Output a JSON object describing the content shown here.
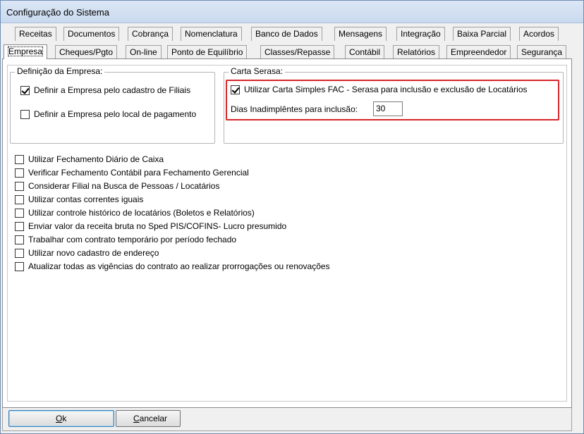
{
  "window": {
    "title": "Configuração do Sistema"
  },
  "tabs_row1": [
    "Receitas",
    "Documentos",
    "Cobrança",
    "Nomenclatura",
    "Banco de Dados",
    "Mensagens",
    "Integração",
    "Baixa Parcial",
    "Acordos"
  ],
  "tabs_row2": [
    "Empresa",
    "Cheques/Pgto",
    "On-line",
    "Ponto de Equilíbrio",
    "Classes/Repasse",
    "Contábil",
    "Relatórios",
    "Empreendedor",
    "Segurança"
  ],
  "active_tab": "Empresa",
  "definicao": {
    "legend": "Definição da Empresa:",
    "opt_filiais": {
      "label": "Definir a Empresa pelo cadastro de Filiais",
      "checked": true
    },
    "opt_local": {
      "label": "Definir a Empresa pelo local de pagamento",
      "checked": false
    }
  },
  "serasa": {
    "legend": "Carta Serasa:",
    "opt_carta": {
      "label": "Utilizar Carta Simples FAC - Serasa para inclusão e exclusão de Locatários",
      "checked": true
    },
    "dias_label": "Dias Inadimplêntes para inclusão:",
    "dias_value": "30",
    "highlight_color": "#d7262b"
  },
  "options": [
    {
      "label": "Utilizar Fechamento Diário de Caixa",
      "checked": false
    },
    {
      "label": "Verificar Fechamento Contábil para Fechamento Gerencial",
      "checked": false
    },
    {
      "label": "Considerar Filial na Busca de Pessoas / Locatários",
      "checked": false
    },
    {
      "label": "Utilizar contas correntes iguais",
      "checked": false
    },
    {
      "label": "Utilizar controle histórico de locatários (Boletos e Relatórios)",
      "checked": false
    },
    {
      "label": "Enviar valor da receita bruta no Sped PIS/COFINS- Lucro presumido",
      "checked": false
    },
    {
      "label": "Trabalhar com contrato temporário por período fechado",
      "checked": false
    },
    {
      "label": "Utilizar novo cadastro de endereço",
      "checked": false
    },
    {
      "label": "Atualizar todas as vigências do contrato ao realizar prorrogações ou renovações",
      "checked": false
    }
  ],
  "buttons": {
    "ok": {
      "mnemonic": "O",
      "rest": "k"
    },
    "cancel": {
      "mnemonic": "C",
      "rest": "ancelar"
    }
  }
}
